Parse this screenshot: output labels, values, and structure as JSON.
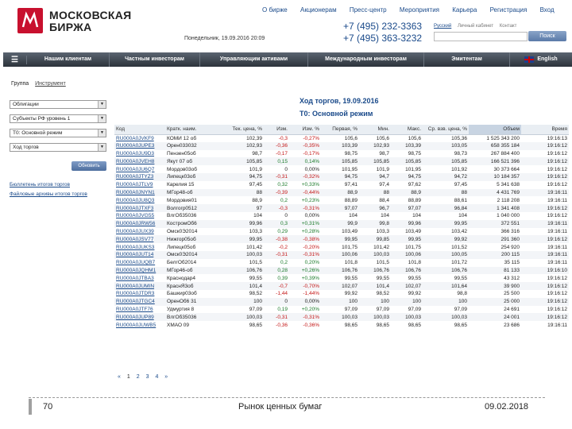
{
  "header": {
    "logo_line1": "МОСКОВСКАЯ",
    "logo_line2": "БИРЖА",
    "topnav": [
      "О бирже",
      "Акционерам",
      "Пресс-центр",
      "Мероприятия",
      "Карьера",
      "Регистрация",
      "Вход"
    ],
    "greeting": "Понедельник, 19.09.2016 20:09",
    "phone1": "+7 (495) 232-3363",
    "phone2": "+7 (495) 363-3232",
    "lang_links": [
      "Русский",
      "Личный кабинет",
      "Контакт"
    ],
    "search_placeholder": "",
    "search_button": "Поиск"
  },
  "mainnav": {
    "items": [
      "Нашим клиентам",
      "Частным инвесторам",
      "Управляющим активами",
      "Международным инвесторам",
      "Эмитентам"
    ],
    "lang": "English"
  },
  "filters": {
    "tab_group": "Группа",
    "tab_instrument": "Инструмент",
    "selects": [
      "Облигации",
      "Субъекты РФ уровень 1",
      "Т0: Основной режим",
      "Ход торгов"
    ],
    "refresh_button": "Обновить",
    "link_archive": "Бюллетень итогов торгов",
    "link_files": "Файловые архивы итогов торгов"
  },
  "trades": {
    "title": "Ход торгов, 19.09.2016",
    "subtitle": "Т0: Основной режим",
    "columns": [
      "Код",
      "Кратк. наим.",
      "Тек. цена, %",
      "Изм.",
      "Изм. %",
      "Первая, %",
      "Мин.",
      "Макс.",
      "Ср. взв. цена, %",
      "Объем",
      "Время"
    ],
    "rows": [
      [
        "RU000A0JVKF9",
        "КОМИ 12 об",
        "102,39",
        "-0,3",
        "-0,27%",
        "105,6",
        "105,6",
        "105,6",
        "105,36",
        "1 525 343 200",
        "19:16:13"
      ],
      [
        "RU000A0JUPE3",
        "Орен033032",
        "102,93",
        "-0,36",
        "-0,35%",
        "103,39",
        "102,93",
        "103,39",
        "103,05",
        "658 355 184",
        "19:16:12"
      ],
      [
        "RU000A0JU9D3",
        "Пензен05об",
        "98,7",
        "-0,17",
        "-0,17%",
        "98,75",
        "98,7",
        "98,75",
        "98,73",
        "267 884 400",
        "19:16:12"
      ],
      [
        "RU000A0JVEH8",
        "Якут 07 об",
        "105,85",
        "0,15",
        "0,14%",
        "105,85",
        "105,85",
        "105,85",
        "105,85",
        "166 521 396",
        "19:16:12"
      ],
      [
        "RU000A0JU6Q7",
        "Мордов03об",
        "101,9",
        "0",
        "0,00%",
        "101,95",
        "101,9",
        "101,95",
        "101,92",
        "30 373 664",
        "19:16:12"
      ],
      [
        "RU000A0JTYZ3",
        "Липецк03об",
        "94,75",
        "-0,31",
        "-0,32%",
        "94,75",
        "94,7",
        "94,75",
        "94,72",
        "10 184 357",
        "19:16:12"
      ],
      [
        "RU000A0JTLV9",
        "Карелия 15",
        "97,45",
        "0,32",
        "+0,33%",
        "97,41",
        "97,4",
        "97,62",
        "97,45",
        "5 341 638",
        "19:16:12"
      ],
      [
        "RU000A0JNYN1",
        "МГор48-об",
        "88",
        "-0,39",
        "-0,44%",
        "88,9",
        "88",
        "88,9",
        "88",
        "4 431 769",
        "19:16:11"
      ],
      [
        "RU000A0JU8Q3",
        "Мордовия01",
        "88,9",
        "0,2",
        "+0,23%",
        "88,89",
        "88,4",
        "88,89",
        "88,61",
        "2 118 208",
        "19:16:11"
      ],
      [
        "RU000A0JTXF3",
        "Волгогр0512",
        "97",
        "-0,3",
        "-0,31%",
        "97,07",
        "96,7",
        "97,07",
        "96,84",
        "1 341 408",
        "19:16:12"
      ],
      [
        "RU000A0JVG55",
        "ВлгОб35036",
        "104",
        "0",
        "0,00%",
        "104",
        "104",
        "104",
        "104",
        "1 040 000",
        "19:16:12"
      ],
      [
        "RU000A0JRW56",
        "КостромОб6",
        "99,96",
        "0,3",
        "+0,31%",
        "99,9",
        "99,8",
        "99,96",
        "99,95",
        "372 551",
        "19:16:11"
      ],
      [
        "RU000A0JUX39",
        "Омск0Э2014",
        "103,3",
        "0,29",
        "+0,28%",
        "103,49",
        "103,3",
        "103,49",
        "103,42",
        "366 316",
        "19:16:11"
      ],
      [
        "RU000A0JSV77",
        "Нижгор05об",
        "99,95",
        "-0,38",
        "-0,38%",
        "99,95",
        "99,85",
        "99,95",
        "99,92",
        "291 360",
        "19:16:12"
      ],
      [
        "RU000A0JUKS3",
        "Липецк05об",
        "101,42",
        "-0,2",
        "-0,20%",
        "101,75",
        "101,42",
        "101,75",
        "101,52",
        "254 920",
        "19:16:11"
      ],
      [
        "RU000A0JUT14",
        "Омск0Э2014",
        "100,03",
        "-0,31",
        "-0,31%",
        "100,06",
        "100,03",
        "100,06",
        "100,05",
        "200 115",
        "19:16:11"
      ],
      [
        "RU000A0JUQB7",
        "БелгОб2014",
        "101,5",
        "0,2",
        "0,20%",
        "101,8",
        "101,5",
        "101,8",
        "101,72",
        "35 115",
        "19:16:11"
      ],
      [
        "RU000A0JQHM1",
        "МГор46-об",
        "106,76",
        "0,28",
        "+0,26%",
        "106,76",
        "106,76",
        "106,76",
        "106,76",
        "81 133",
        "19:16:10"
      ],
      [
        "RU000A0JTBA3",
        "Краснодар4",
        "99,55",
        "0,39",
        "+0,39%",
        "99,55",
        "99,55",
        "99,55",
        "99,55",
        "43 312",
        "19:16:12"
      ],
      [
        "RU000A0JUMIN",
        "КраснЯ3об",
        "101,4",
        "-0,7",
        "-0,70%",
        "102,07",
        "101,4",
        "102,07",
        "101,64",
        "39 900",
        "19:16:12"
      ],
      [
        "RU000A0JTDR3",
        "Башкир03об",
        "98,52",
        "-1,44",
        "-1,44%",
        "99,92",
        "98,52",
        "99,92",
        "98,8",
        "25 500",
        "19:16:12"
      ],
      [
        "RU000A0JTGC4",
        "ОренОб6 31",
        "100",
        "0",
        "0,00%",
        "100",
        "100",
        "100",
        "100",
        "25 000",
        "19:16:12"
      ],
      [
        "RU000A0JTF76",
        "Удмуртия 8",
        "97,09",
        "0,19",
        "+0,20%",
        "97,09",
        "97,09",
        "97,09",
        "97,09",
        "24 691",
        "19:16:12"
      ],
      [
        "RU000A0JUP89",
        "ВлгОб35036",
        "100,03",
        "-0,31",
        "-0,31%",
        "100,03",
        "100,03",
        "100,03",
        "100,03",
        "24 001",
        "19:16:12"
      ],
      [
        "RU000A0JUWB5",
        "ХМАО 09",
        "98,65",
        "-0,36",
        "-0,36%",
        "98,65",
        "98,65",
        "98,65",
        "98,65",
        "23 686",
        "19:16:11"
      ]
    ]
  },
  "pager": [
    "«",
    "1",
    "2",
    "3",
    "4",
    "»"
  ],
  "footer": {
    "page_number": "70",
    "title": "Рынок ценных бумаг",
    "date": "09.02.2018"
  },
  "colors": {
    "brand_red": "#c8102e",
    "link_blue": "#1a4a8a",
    "positive": "#1a7a2a",
    "negative": "#c41616"
  }
}
